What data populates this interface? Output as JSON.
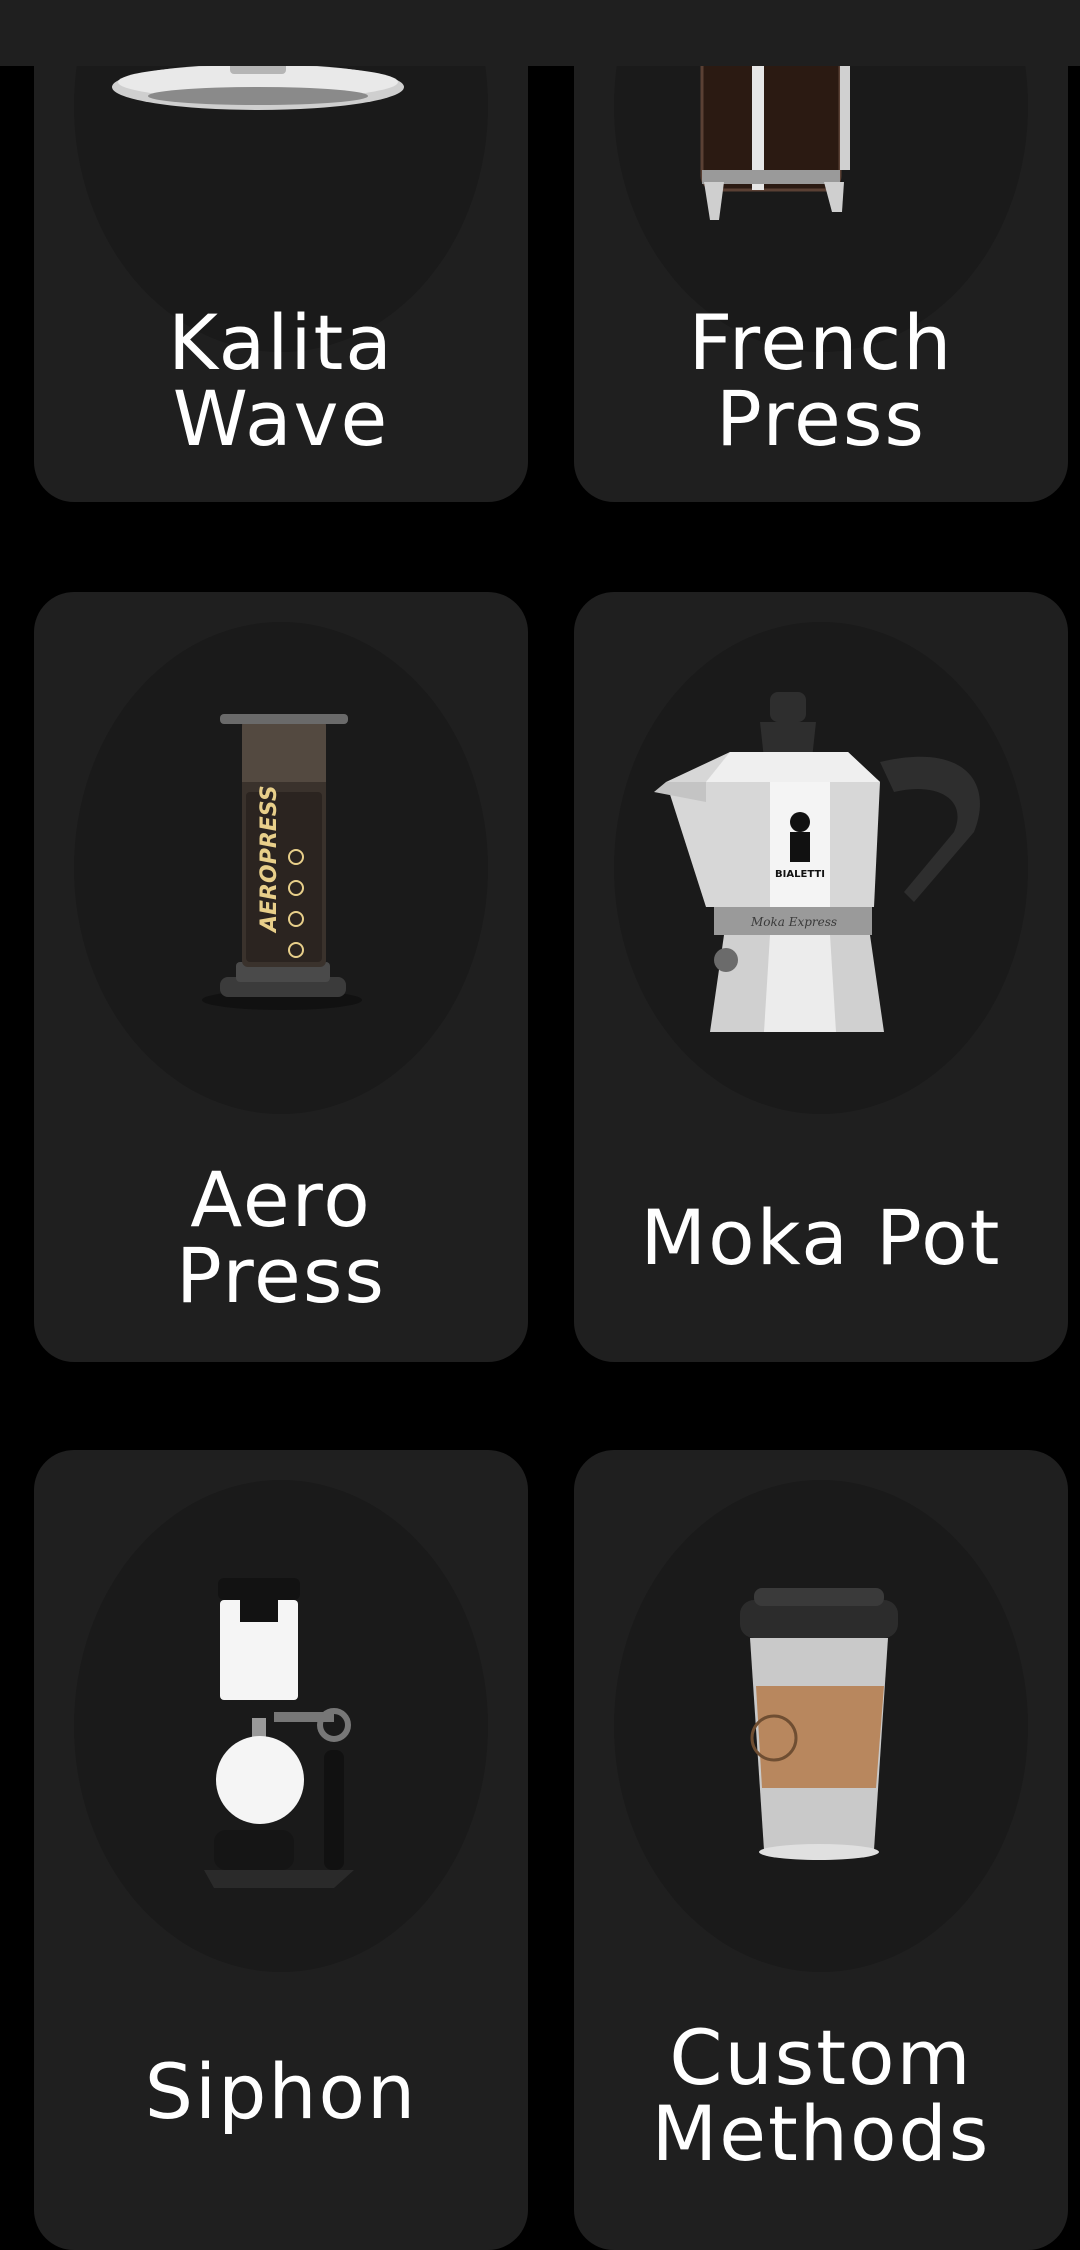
{
  "methods": [
    {
      "id": "kalita-wave",
      "line1": "Kalita",
      "line2": "Wave"
    },
    {
      "id": "french-press",
      "line1": "French",
      "line2": "Press"
    },
    {
      "id": "aero-press",
      "line1": "Aero",
      "line2": "Press",
      "brand": "AEROPRESS"
    },
    {
      "id": "moka-pot",
      "line1": "Moka Pot",
      "brand": "BIALETTI",
      "script": "Moka Express"
    },
    {
      "id": "siphon",
      "line1": "Siphon"
    },
    {
      "id": "custom-methods",
      "line1": "Custom",
      "line2": "Methods"
    }
  ],
  "colors": {
    "background": "#000000",
    "card": "#1f1f1f",
    "halo": "#1a1a1a",
    "text": "#ffffff"
  }
}
